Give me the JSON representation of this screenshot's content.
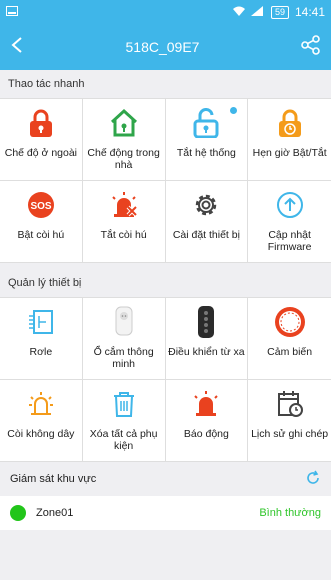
{
  "status": {
    "time": "14:41",
    "battery": "59"
  },
  "header": {
    "title": "518C_09E7"
  },
  "quick": {
    "title": "Thao tác nhanh",
    "items": [
      {
        "label": "Chế độ ở ngoài",
        "icon": "lock-red-icon"
      },
      {
        "label": "Chế động trong nhà",
        "icon": "home-green-icon"
      },
      {
        "label": "Tắt hệ thống",
        "icon": "unlock-blue-icon"
      },
      {
        "label": "Hẹn giờ Bật/Tắt",
        "icon": "timer-lock-icon"
      },
      {
        "label": "Bật còi hú",
        "icon": "sos-icon"
      },
      {
        "label": "Tắt còi hú",
        "icon": "siren-off-icon"
      },
      {
        "label": "Cài đặt thiết bị",
        "icon": "gear-icon"
      },
      {
        "label": "Cập nhật Firmware",
        "icon": "upload-icon"
      }
    ]
  },
  "devices": {
    "title": "Quản lý thiết bị",
    "items": [
      {
        "label": "Rơle",
        "icon": "relay-icon"
      },
      {
        "label": "Ổ cắm thông minh",
        "icon": "smart-plug-icon"
      },
      {
        "label": "Điều khiển từ xa",
        "icon": "remote-icon"
      },
      {
        "label": "Cảm biến",
        "icon": "sensor-icon"
      },
      {
        "label": "Còi không dây",
        "icon": "wireless-siren-icon"
      },
      {
        "label": "Xóa tất cả phụ kiện",
        "icon": "trash-icon"
      },
      {
        "label": "Báo động",
        "icon": "alarm-icon"
      },
      {
        "label": "Lịch sử ghi chép",
        "icon": "history-icon"
      }
    ]
  },
  "monitor": {
    "title": "Giám sát khu vực",
    "zone": "Zone01",
    "status": "Bình thường"
  }
}
